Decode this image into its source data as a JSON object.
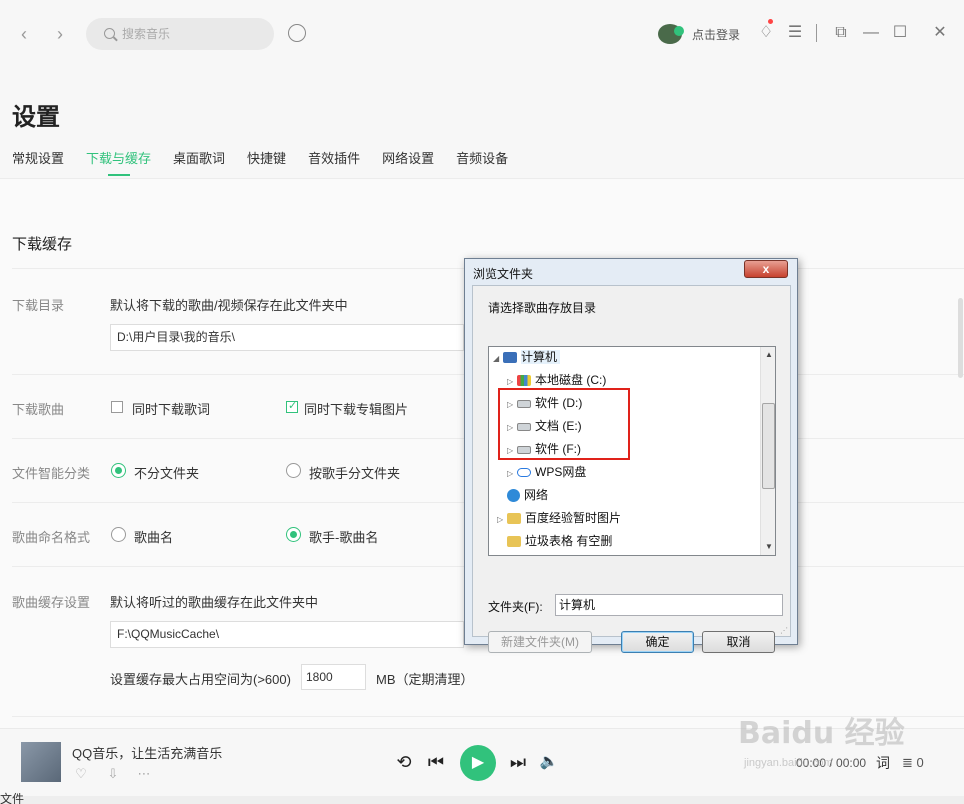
{
  "topbar": {
    "back": "‹",
    "forward": "›",
    "search_placeholder": "搜索音乐",
    "login_label": "点击登录",
    "skin_icon": "♢",
    "menu_icon": "☰",
    "mini_icon": "⧉",
    "minimize_icon": "—",
    "maximize_icon": "☐",
    "close_icon": "✕"
  },
  "settings": {
    "title": "设置",
    "tabs": [
      "常规设置",
      "下载与缓存",
      "桌面歌词",
      "快捷键",
      "音效插件",
      "网络设置",
      "音频设备"
    ],
    "active_tab": "下载与缓存"
  },
  "download_cache": {
    "section_title": "下载缓存",
    "dir_label": "下载目录",
    "dir_desc": "默认将下载的歌曲/视频保存在此文件夹中",
    "dir_path": "D:\\用户目录\\我的音乐\\",
    "songs_label": "下载歌曲",
    "opt_lyrics": "同时下载歌词",
    "opt_lyrics_checked": false,
    "opt_cover": "同时下载专辑图片",
    "opt_cover_checked": true,
    "classify_label": "文件智能分类",
    "classify_opt1": "不分文件夹",
    "classify_opt2": "按歌手分文件夹",
    "naming_label": "歌曲命名格式",
    "naming_opt1": "歌曲名",
    "naming_opt2": "歌手-歌曲名",
    "cache_label": "歌曲缓存设置",
    "cache_desc": "默认将听过的歌曲缓存在此文件夹中",
    "cache_path": "F:\\QQMusicCache\\",
    "cache_size_prefix": "设置缓存最大占用空间为(>600)",
    "cache_size_value": "1800",
    "cache_size_suffix": "MB（定期清理）"
  },
  "player": {
    "song_title": "QQ音乐，让生活充满音乐",
    "time": "00:00 / 00:00",
    "lyric_button": "词",
    "playlist_count": "0",
    "bottom_text": "文件"
  },
  "watermark": {
    "main": "Baidu 经验",
    "sub": "jingyan.baidu.com"
  },
  "dialog": {
    "title": "浏览文件夹",
    "close_label": "x",
    "prompt": "请选择歌曲存放目录",
    "tree": [
      {
        "label": "计算机",
        "icon": "computer-icon"
      },
      {
        "label": "本地磁盘 (C:)",
        "icon": "system-drive-icon"
      },
      {
        "label": "软件 (D:)",
        "icon": "drive-icon"
      },
      {
        "label": "文档 (E:)",
        "icon": "drive-icon"
      },
      {
        "label": "软件 (F:)",
        "icon": "drive-icon"
      },
      {
        "label": "WPS网盘",
        "icon": "cloud-icon"
      },
      {
        "label": "网络",
        "icon": "network-icon"
      },
      {
        "label": "百度经验暂时图片",
        "icon": "folder-icon"
      },
      {
        "label": "垃圾表格 有空删",
        "icon": "folder-icon"
      }
    ],
    "folder_label": "文件夹(F):",
    "folder_value": "计算机",
    "new_folder_button": "新建文件夹(M)",
    "ok_button": "确定",
    "cancel_button": "取消"
  },
  "colors": {
    "accent": "#31c27c",
    "highlight_box": "#e0221a"
  }
}
